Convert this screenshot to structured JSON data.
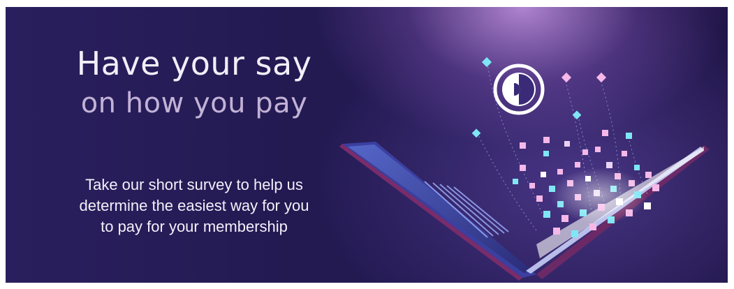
{
  "banner": {
    "headline": "Have your say",
    "subheadline": "on how you pay",
    "body_lines": [
      "Take our short survey to help us",
      "determine the easiest way for you",
      "to pay for your membership"
    ],
    "logo_icon": "diners-club-logo",
    "illustration": "laptop-icon",
    "colors": {
      "background": "#231a52",
      "glow": "#c896e6",
      "particle_pink": "#f5b8e8",
      "particle_cyan": "#7fe6f5"
    }
  }
}
